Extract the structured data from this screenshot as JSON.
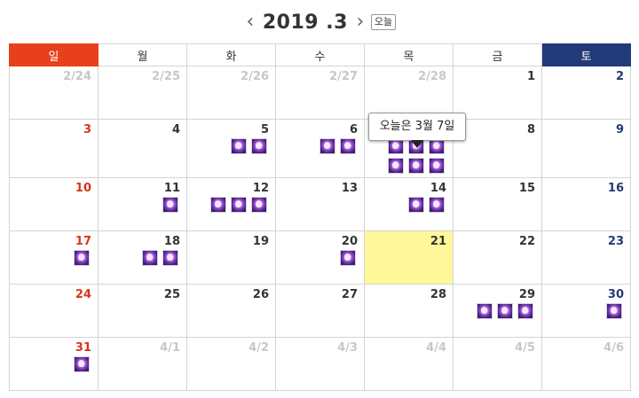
{
  "header": {
    "prev": "‹",
    "title": "2019 .3",
    "next": "›",
    "today_label": "오늘"
  },
  "weekdays": [
    "일",
    "월",
    "화",
    "수",
    "목",
    "금",
    "토"
  ],
  "tooltip": "오늘은 3월 7일",
  "weeks": [
    [
      {
        "d": "2/24",
        "o": true,
        "e": 0
      },
      {
        "d": "2/25",
        "o": true,
        "e": 0
      },
      {
        "d": "2/26",
        "o": true,
        "e": 0
      },
      {
        "d": "2/27",
        "o": true,
        "e": 0
      },
      {
        "d": "2/28",
        "o": true,
        "e": 0
      },
      {
        "d": "1",
        "e": 0
      },
      {
        "d": "2",
        "e": 0
      }
    ],
    [
      {
        "d": "3",
        "e": 0
      },
      {
        "d": "4",
        "e": 0
      },
      {
        "d": "5",
        "e": 2
      },
      {
        "d": "6",
        "e": 2
      },
      {
        "d": "7",
        "e": 6,
        "hide": true
      },
      {
        "d": "8",
        "e": 0
      },
      {
        "d": "9",
        "e": 0
      }
    ],
    [
      {
        "d": "10",
        "e": 0
      },
      {
        "d": "11",
        "e": 1
      },
      {
        "d": "12",
        "e": 3
      },
      {
        "d": "13",
        "e": 0
      },
      {
        "d": "14",
        "e": 2
      },
      {
        "d": "15",
        "e": 0
      },
      {
        "d": "16",
        "e": 0
      }
    ],
    [
      {
        "d": "17",
        "e": 1
      },
      {
        "d": "18",
        "e": 2
      },
      {
        "d": "19",
        "e": 0
      },
      {
        "d": "20",
        "e": 1
      },
      {
        "d": "21",
        "e": 0,
        "today": true
      },
      {
        "d": "22",
        "e": 0
      },
      {
        "d": "23",
        "e": 0
      }
    ],
    [
      {
        "d": "24",
        "e": 0
      },
      {
        "d": "25",
        "e": 0
      },
      {
        "d": "26",
        "e": 0
      },
      {
        "d": "27",
        "e": 0
      },
      {
        "d": "28",
        "e": 0
      },
      {
        "d": "29",
        "e": 3
      },
      {
        "d": "30",
        "e": 1
      }
    ],
    [
      {
        "d": "31",
        "e": 1
      },
      {
        "d": "4/1",
        "o": true,
        "e": 0
      },
      {
        "d": "4/2",
        "o": true,
        "e": 0
      },
      {
        "d": "4/3",
        "o": true,
        "e": 0
      },
      {
        "d": "4/4",
        "o": true,
        "e": 0
      },
      {
        "d": "4/5",
        "o": true,
        "e": 0
      },
      {
        "d": "4/6",
        "o": true,
        "e": 0
      }
    ]
  ]
}
